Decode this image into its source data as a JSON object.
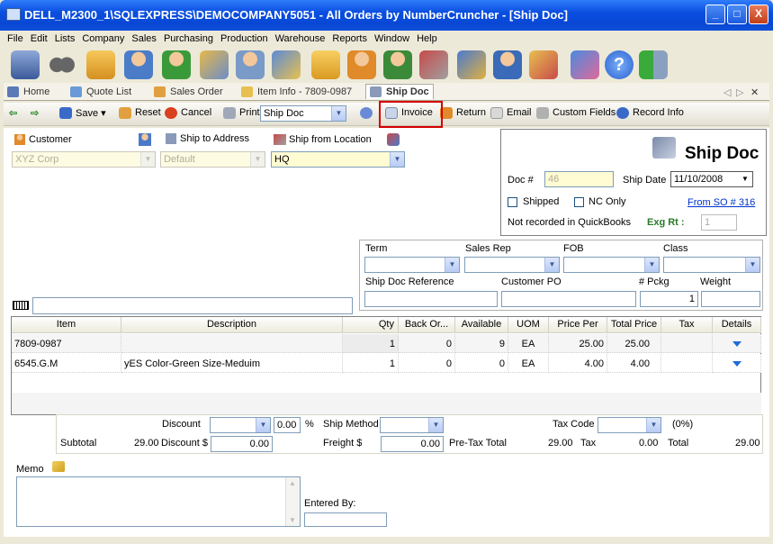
{
  "window": {
    "title": "DELL_M2300_1\\SQLEXPRESS\\DEMOCOMPANY5051 - All Orders by NumberCruncher - [Ship Doc]",
    "minimize": "_",
    "maximize": "□",
    "close": "X"
  },
  "menu": [
    "File",
    "Edit",
    "Lists",
    "Company",
    "Sales",
    "Purchasing",
    "Production",
    "Warehouse",
    "Reports",
    "Window",
    "Help"
  ],
  "toolbar_icons": [
    "database-icon",
    "binoculars-icon",
    "package-check-icon",
    "customer-check-icon",
    "vendor-check-icon",
    "inventory-check-icon",
    "vendor-report-icon",
    "orders-icon",
    "box-icon",
    "customer-icon",
    "contact-icon",
    "shipping-icon",
    "users-icon",
    "employee-icon",
    "security-icon",
    "edit-icon",
    "help-icon",
    "exit-icon"
  ],
  "tabs": [
    {
      "label": "Home",
      "icon": "home-icon"
    },
    {
      "label": "Quote List",
      "icon": "quote-icon"
    },
    {
      "label": "Sales Order",
      "icon": "sales-order-icon"
    },
    {
      "label": "Item Info - 7809-0987",
      "icon": "item-icon"
    },
    {
      "label": "Ship Doc",
      "icon": "truck-icon"
    }
  ],
  "tab_controls": {
    "prev": "◁",
    "next": "▷",
    "close": "✕"
  },
  "commands": {
    "save": "Save",
    "reset": "Reset",
    "cancel": "Cancel",
    "print": "Print",
    "print_option": "Ship Doc",
    "invoice": "Invoice",
    "return": "Return",
    "email": "Email",
    "custom_fields": "Custom Fields",
    "record_info": "Record Info"
  },
  "header": {
    "customer_label": "Customer",
    "customer_value": "XYZ Corp",
    "ship_to_label": "Ship to Address",
    "ship_to_value": "Default",
    "ship_from_label": "Ship from Location",
    "ship_from_value": "HQ"
  },
  "shipdoc": {
    "title": "Ship Doc",
    "doc_label": "Doc #",
    "doc_value": "46",
    "date_label": "Ship Date",
    "date_value": "11/10/2008",
    "shipped_label": "Shipped",
    "nc_only_label": "NC Only",
    "from_so": "From SO # 316",
    "qb_status": "Not recorded in QuickBooks",
    "exg_label": "Exg Rt :",
    "exg_value": "1"
  },
  "terms": {
    "term_label": "Term",
    "rep_label": "Sales Rep",
    "fob_label": "FOB",
    "class_label": "Class",
    "ref_label": "Ship Doc Reference",
    "po_label": "Customer PO",
    "pckg_label": "# Pckg",
    "pckg_value": "1",
    "weight_label": "Weight"
  },
  "grid": {
    "headers": [
      "Item",
      "Description",
      "Qty",
      "Back Or...",
      "Available",
      "UOM",
      "Price Per",
      "Total Price",
      "Tax",
      "Details"
    ],
    "rows": [
      [
        "7809-0987",
        "",
        "1",
        "0",
        "9",
        "EA",
        "25.00",
        "25.00",
        "",
        ""
      ],
      [
        "6545.G.M",
        "yES Color-Green Size-Meduim",
        "1",
        "0",
        "0",
        "EA",
        "4.00",
        "4.00",
        "",
        ""
      ]
    ]
  },
  "totals": {
    "discount_label": "Discount",
    "discount_pct": "0.00",
    "pct_sign": "%",
    "ship_method_label": "Ship Method",
    "tax_code_label": "Tax Code",
    "tax_pct": "(0%)",
    "subtotal_label": "Subtotal",
    "subtotal": "29.00",
    "discount_amt_label": "Discount $",
    "discount_amt": "0.00",
    "freight_label": "Freight $",
    "freight": "0.00",
    "pretax_label": "Pre-Tax Total",
    "pretax": "29.00",
    "tax_label": "Tax",
    "tax": "0.00",
    "total_label": "Total",
    "total": "29.00"
  },
  "memo": {
    "label": "Memo",
    "entered_by_label": "Entered By:"
  },
  "colors": {
    "accent": "#0a4ee0",
    "highlight": "#d40000"
  }
}
